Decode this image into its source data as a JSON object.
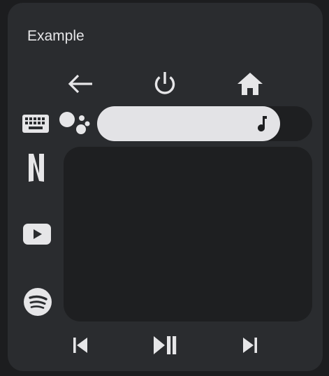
{
  "card": {
    "title": "Example"
  },
  "nav": {
    "back_icon": "arrow-left-icon",
    "power_icon": "power-icon",
    "home_icon": "home-icon"
  },
  "side_apps": {
    "items": [
      "keyboard-icon",
      "netflix-icon",
      "youtube-icon",
      "spotify-icon"
    ]
  },
  "assistant": {
    "icon": "google-assistant-icon"
  },
  "volume": {
    "icon": "music-note-icon",
    "level_percent": 85
  },
  "touchpad": {},
  "media": {
    "previous_icon": "skip-previous-icon",
    "play_pause_icon": "play-pause-icon",
    "next_icon": "skip-next-icon"
  },
  "colors": {
    "background": "#1c1d1f",
    "card": "#2a2c2f",
    "surface": "#1e1f21",
    "icon": "#e3e3e6"
  }
}
